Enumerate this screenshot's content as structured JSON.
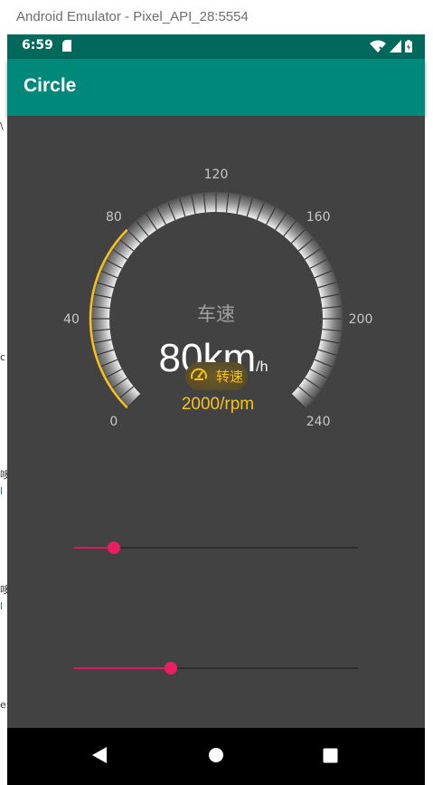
{
  "window": {
    "title": "Android Emulator - Pixel_API_28:5554"
  },
  "status_bar": {
    "time": "6:59",
    "icons": [
      "sd-card-icon",
      "wifi-icon",
      "signal-icon",
      "battery-icon"
    ]
  },
  "app_bar": {
    "title": "Circle",
    "color": "#00897b"
  },
  "gauge": {
    "label": "车速",
    "speed_value": "80",
    "speed_unit_main": "km",
    "speed_unit_sub": "/h",
    "badge_label": "转速",
    "rpm_text": "2000/rpm",
    "min": 0,
    "max": 240,
    "current": 80,
    "tick_labels": [
      "0",
      "40",
      "80",
      "120",
      "160",
      "200",
      "240"
    ],
    "accent_color": "#f9c21a"
  },
  "sliders": [
    {
      "name": "speed-slider",
      "progress": 0.14
    },
    {
      "name": "rpm-slider",
      "progress": 0.34
    }
  ],
  "left_edge_fragments": [
    "\\",
    "c",
    "哆",
    "l",
    "哆",
    "l",
    "e"
  ],
  "navigation": {
    "buttons": [
      "back-icon",
      "home-icon",
      "recents-icon"
    ]
  }
}
